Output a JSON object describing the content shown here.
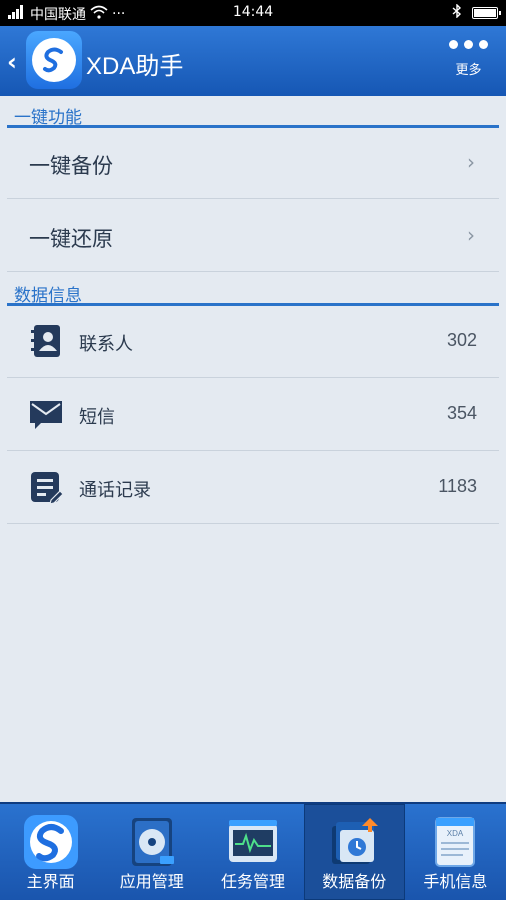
{
  "status_bar": {
    "carrier": "中国联通",
    "time": "14:44",
    "battery_level": 0.9
  },
  "header": {
    "title": "XDA助手",
    "more_label": "更多"
  },
  "sections": {
    "one_key": {
      "title": "一键功能",
      "items": [
        {
          "label": "一键备份"
        },
        {
          "label": "一键还原"
        }
      ]
    },
    "data_info": {
      "title": "数据信息",
      "items": [
        {
          "label": "联系人",
          "count": "302",
          "icon": "contacts-book-icon"
        },
        {
          "label": "短信",
          "count": "354",
          "icon": "envelope-icon"
        },
        {
          "label": "通话记录",
          "count": "1183",
          "icon": "call-log-icon"
        }
      ]
    }
  },
  "bottom_nav": {
    "items": [
      {
        "label": "主界面",
        "icon": "home-logo-icon"
      },
      {
        "label": "应用管理",
        "icon": "app-manage-icon"
      },
      {
        "label": "任务管理",
        "icon": "task-manage-icon"
      },
      {
        "label": "数据备份",
        "icon": "data-backup-icon",
        "active": true
      },
      {
        "label": "手机信息",
        "icon": "phone-info-icon"
      }
    ]
  },
  "colors": {
    "header": "#1f66c4",
    "accent": "#2a73c9",
    "background": "#e4eaf1",
    "icon_dark": "#243a5c"
  }
}
